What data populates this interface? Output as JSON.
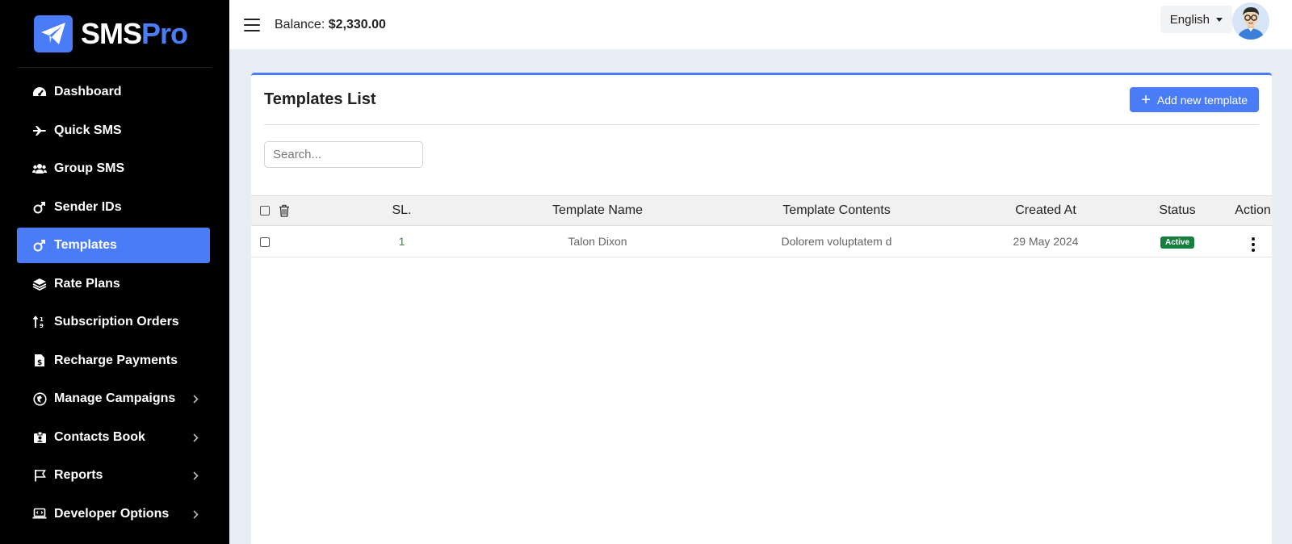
{
  "brand": {
    "name_main": "SMS",
    "name_accent": "Pro"
  },
  "sidebar": {
    "items": [
      {
        "label": "Dashboard"
      },
      {
        "label": "Quick SMS"
      },
      {
        "label": "Group SMS"
      },
      {
        "label": "Sender IDs"
      },
      {
        "label": "Templates"
      },
      {
        "label": "Rate Plans"
      },
      {
        "label": "Subscription Orders"
      },
      {
        "label": "Recharge Payments"
      },
      {
        "label": "Manage Campaigns"
      },
      {
        "label": "Contacts Book"
      },
      {
        "label": "Reports"
      },
      {
        "label": "Developer Options"
      }
    ]
  },
  "header": {
    "balance_label": "Balance:",
    "balance_value": "$2,330.00",
    "language": "English"
  },
  "card": {
    "title": "Templates List",
    "add_button": "Add new template",
    "search_placeholder": "Search..."
  },
  "table": {
    "columns": [
      "SL.",
      "Template Name",
      "Template Contents",
      "Created At",
      "Status",
      "Action"
    ],
    "rows": [
      {
        "sl": "1",
        "name": "Talon Dixon",
        "contents": "Dolorem voluptatem d",
        "created": "29 May 2024",
        "status": "Active"
      }
    ]
  },
  "colors": {
    "accent": "#4a7cf7",
    "sidebar_bg": "#000000",
    "status_active": "#15803d"
  }
}
